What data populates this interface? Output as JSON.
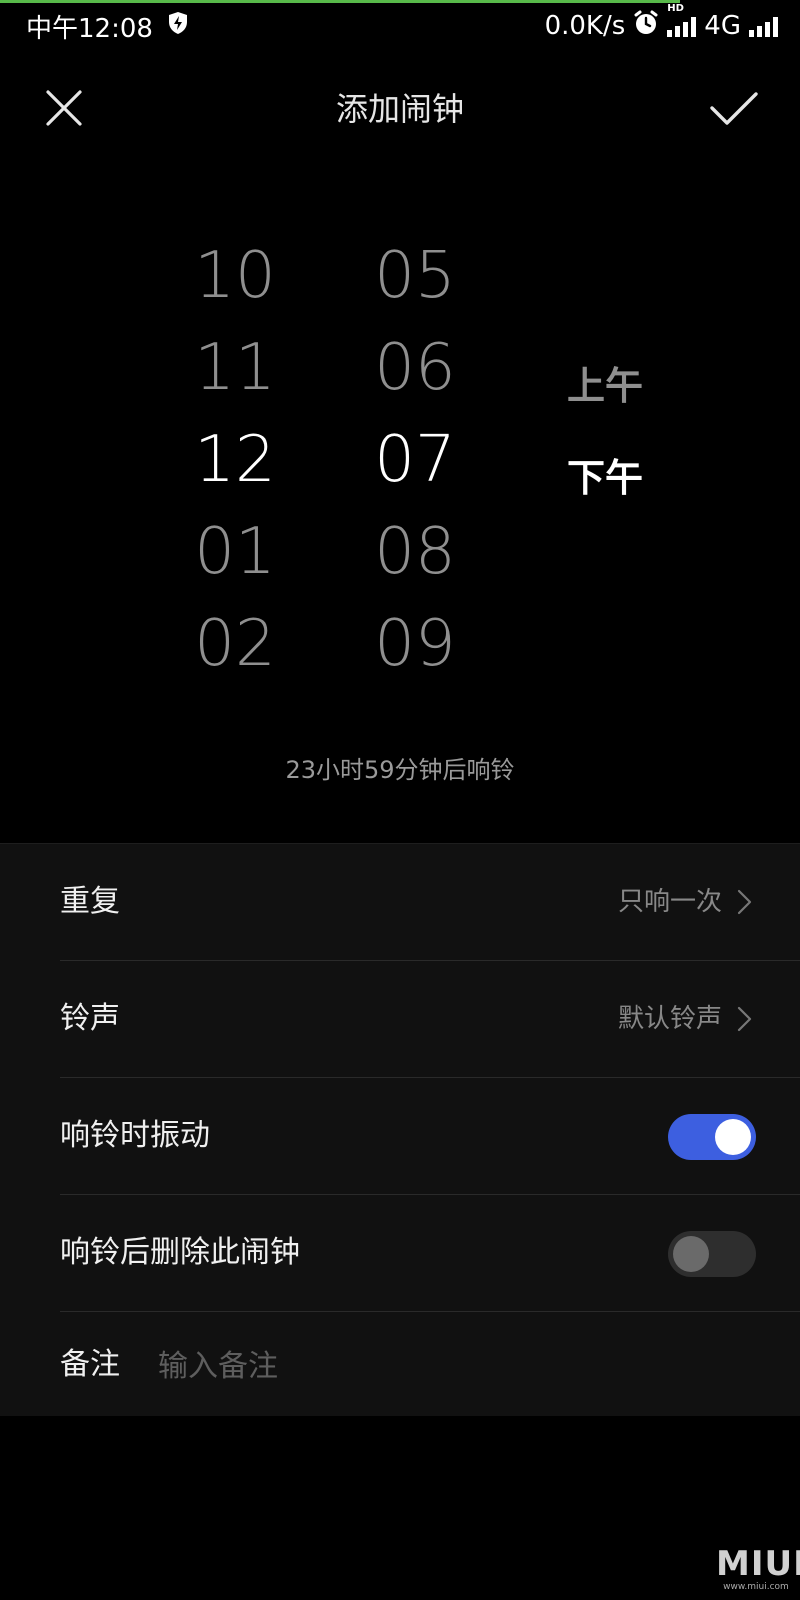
{
  "status_bar": {
    "time": "中午12:08",
    "net_speed": "0.0K/s",
    "hd_label": "HD",
    "network": "4G",
    "icons": [
      "shield-bolt-icon",
      "alarm-icon",
      "signal-icon",
      "signal-icon"
    ]
  },
  "header": {
    "title": "添加闹钟",
    "close_icon": "close-icon",
    "confirm_icon": "check-icon"
  },
  "picker": {
    "hours": [
      "10",
      "11",
      "12",
      "01",
      "02"
    ],
    "minutes": [
      "05",
      "06",
      "07",
      "08",
      "09"
    ],
    "ampm": [
      "上午",
      "下午"
    ],
    "selected_hour": "12",
    "selected_minute": "07",
    "selected_ampm": "下午"
  },
  "countdown_text": "23小时59分钟后响铃",
  "settings": {
    "repeat": {
      "label": "重复",
      "value": "只响一次"
    },
    "ringtone": {
      "label": "铃声",
      "value": "默认铃声"
    },
    "vibrate": {
      "label": "响铃时振动",
      "enabled": true
    },
    "delete_after": {
      "label": "响铃后删除此闹钟",
      "enabled": false
    },
    "note": {
      "label": "备注",
      "placeholder": "输入备注",
      "value": ""
    }
  },
  "colors": {
    "accent": "#3d5fe0",
    "background": "#000000",
    "list_background": "#111111",
    "progress": "#58b94a"
  },
  "watermark": {
    "brand": "MIUI",
    "url": "www.miui.com"
  }
}
